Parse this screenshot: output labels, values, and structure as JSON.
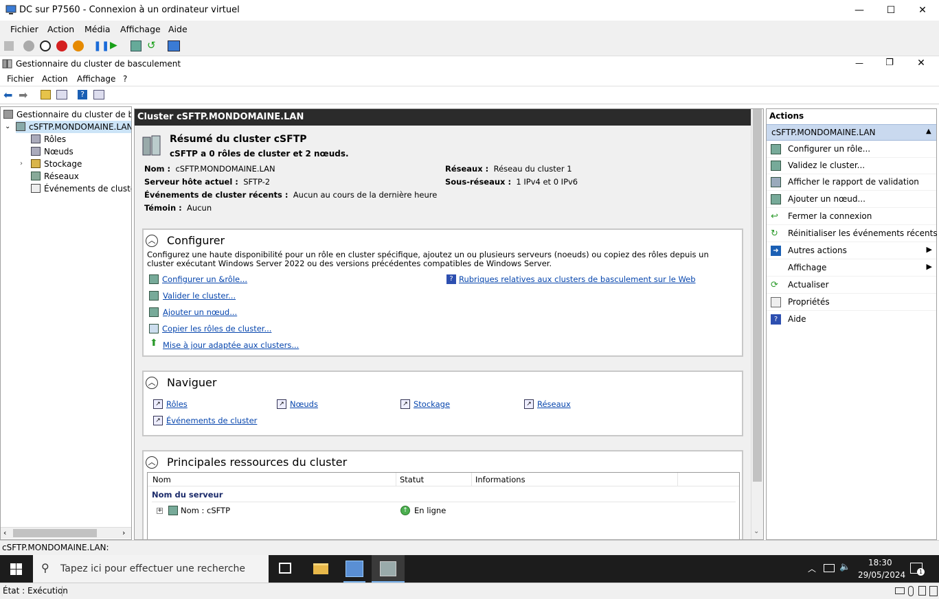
{
  "vm_window": {
    "title": "DC sur P7560 - Connexion à un ordinateur virtuel",
    "menu": [
      "Fichier",
      "Action",
      "Média",
      "Affichage",
      "Aide"
    ],
    "minimize": "—",
    "maximize": "☐",
    "close": "✕"
  },
  "mmc_window": {
    "title": "Gestionnaire du cluster de basculement",
    "menu": [
      "Fichier",
      "Action",
      "Affichage",
      "?"
    ],
    "minimize": "—",
    "restore": "❐",
    "close": "✕"
  },
  "tree": {
    "root": "Gestionnaire du cluster de basc",
    "cluster": "cSFTP.MONDOMAINE.LAN",
    "children": [
      "Rôles",
      "Nœuds",
      "Stockage",
      "Réseaux",
      "Événements de cluster"
    ]
  },
  "center": {
    "header": "Cluster cSFTP.MONDOMAINE.LAN",
    "summary_title": "Résumé du cluster cSFTP",
    "summary_sub": "cSFTP a 0 rôles de cluster et 2 nœuds.",
    "props": {
      "nom_label": "Nom :",
      "nom_value": "cSFTP.MONDOMAINE.LAN",
      "host_label": "Serveur hôte actuel :",
      "host_value": "SFTP-2",
      "events_label": "Événements de cluster récents :",
      "events_value": "Aucun au cours de la dernière heure",
      "witness_label": "Témoin :",
      "witness_value": "Aucun",
      "networks_label": "Réseaux :",
      "networks_value": "Réseau du cluster 1",
      "subnets_label": "Sous-réseaux :",
      "subnets_value": "1 IPv4 et 0 IPv6"
    },
    "configure": {
      "title": "Configurer",
      "description": "Configurez une haute disponibilité pour un rôle en cluster spécifique, ajoutez un ou plusieurs serveurs (noeuds) ou copiez des rôles depuis un cluster exécutant Windows Server 2022 ou des versions précédentes compatibles de Windows Server.",
      "links": [
        "Configurer un &rôle...",
        "Valider le cluster...",
        "Ajouter un nœud...",
        "Copier les rôles de cluster...",
        "Mise à jour adaptée aux clusters..."
      ],
      "help_link": "Rubriques relatives aux clusters de basculement sur le Web"
    },
    "navigate": {
      "title": "Naviguer",
      "links": [
        "Rôles",
        "Nœuds",
        "Stockage",
        "Réseaux",
        "Événements de cluster"
      ]
    },
    "resources": {
      "title": "Principales ressources du cluster",
      "columns": [
        "Nom",
        "Statut",
        "Informations"
      ],
      "group": "Nom du serveur",
      "row_name": "Nom : cSFTP",
      "row_status": "En ligne"
    }
  },
  "actions": {
    "header": "Actions",
    "section": "cSFTP.MONDOMAINE.LAN",
    "items": [
      "Configurer un rôle...",
      "Validez le cluster...",
      "Afficher le rapport de validation",
      "Ajouter un nœud...",
      "Fermer la connexion",
      "Réinitialiser les événements récents",
      "Autres actions",
      "Affichage",
      "Actualiser",
      "Propriétés",
      "Aide"
    ]
  },
  "statusbar": "cSFTP.MONDOMAINE.LAN:",
  "taskbar": {
    "search_placeholder": "Tapez ici pour effectuer une recherche",
    "time": "18:30",
    "date": "29/05/2024",
    "notif_count": "1"
  },
  "vm_status": "État : Exécution"
}
